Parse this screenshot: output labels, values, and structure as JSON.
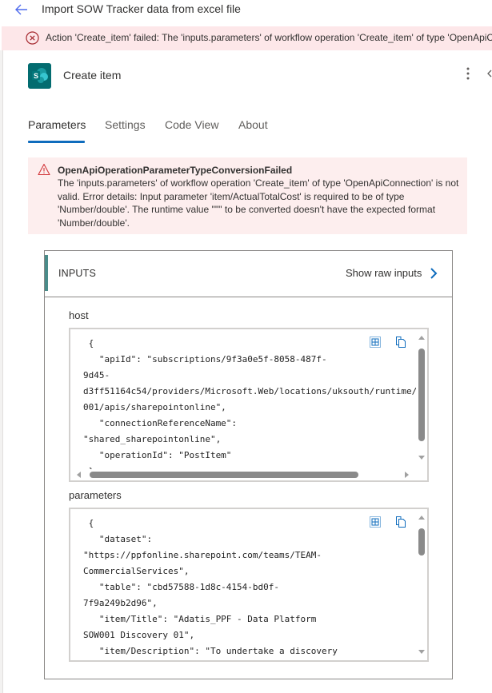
{
  "topbar": {
    "title": "Import SOW Tracker data from excel file",
    "back_icon": "arrow-left-icon"
  },
  "fail_banner": {
    "icon": "error-circle-icon",
    "text": "Action 'Create_item' failed: The 'inputs.parameters' of workflow operation 'Create_item' of type 'OpenApiConnection' is not valid."
  },
  "action": {
    "title": "Create item",
    "logo_icon": "sharepoint-icon",
    "more_icon": "more-vertical-icon",
    "colors": {
      "brand": "#036c70",
      "accent": "#0f6cbd",
      "error_bg": "#fdeeee"
    }
  },
  "tabs": [
    {
      "label": "Parameters",
      "active": true
    },
    {
      "label": "Settings",
      "active": false
    },
    {
      "label": "Code View",
      "active": false
    },
    {
      "label": "About",
      "active": false
    }
  ],
  "error": {
    "icon": "warning-triangle-icon",
    "title": "OpenApiOperationParameterTypeConversionFailed",
    "body": "The 'inputs.parameters' of workflow operation 'Create_item' of type 'OpenApiConnection' is not valid. Error details: Input parameter 'item/ActualTotalCost' is required to be of type 'Number/double'. The runtime value '\"\"' to be converted doesn't have the expected format 'Number/double'."
  },
  "inputs": {
    "title": "INPUTS",
    "show_raw_label": "Show raw inputs",
    "fields": [
      {
        "label": "host",
        "code": " {\n   \"apiId\": \"subscriptions/9f3a0e5f-8058-487f-\n9d45-\nd3ff51164c54/providers/Microsoft.Web/locations/uksouth/runtime/\n001/apis/sharepointonline\",\n   \"connectionReferenceName\":\n\"shared_sharepointonline\",\n   \"operationId\": \"PostItem\"\n }"
      },
      {
        "label": "parameters",
        "code": " {\n   \"dataset\":\n\"https://ppfonline.sharepoint.com/teams/TEAM-\nCommercialServices\",\n   \"table\": \"cbd57588-1d8c-4154-bd0f-\n7f9a249b2d96\",\n   \"item/Title\": \"Adatis_PPF - Data Platform\nSOW001 Discovery 01\",\n   \"item/Description\": \"To undertake a discovery"
      }
    ]
  }
}
